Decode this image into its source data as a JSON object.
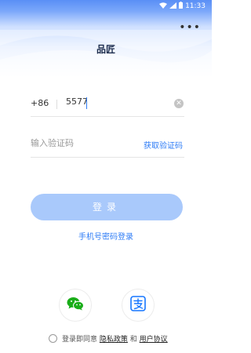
{
  "status_bar": {
    "time": "11:33",
    "icons": [
      "wifi-icon",
      "signal-icon",
      "battery-icon"
    ]
  },
  "header": {
    "title": "品匠",
    "more_icon": "more-icon"
  },
  "form": {
    "country_code": "+86",
    "phone_value": "5577",
    "clear_icon": "clear-icon",
    "code_placeholder": "输入验证码",
    "get_code_label": "获取验证码"
  },
  "actions": {
    "login_label": "登录",
    "password_login_label": "手机号密码登录"
  },
  "social": {
    "wechat_icon": "wechat-icon",
    "alipay_icon": "alipay-icon"
  },
  "agreement": {
    "prefix": "登录即同意",
    "privacy_label": "隐私政策",
    "and": "和",
    "user_agreement_label": "用户协议"
  },
  "colors": {
    "accent": "#2e7cf6",
    "login_button": "#a9c9fb",
    "wechat": "#1aad19",
    "alipay": "#1677ff"
  }
}
